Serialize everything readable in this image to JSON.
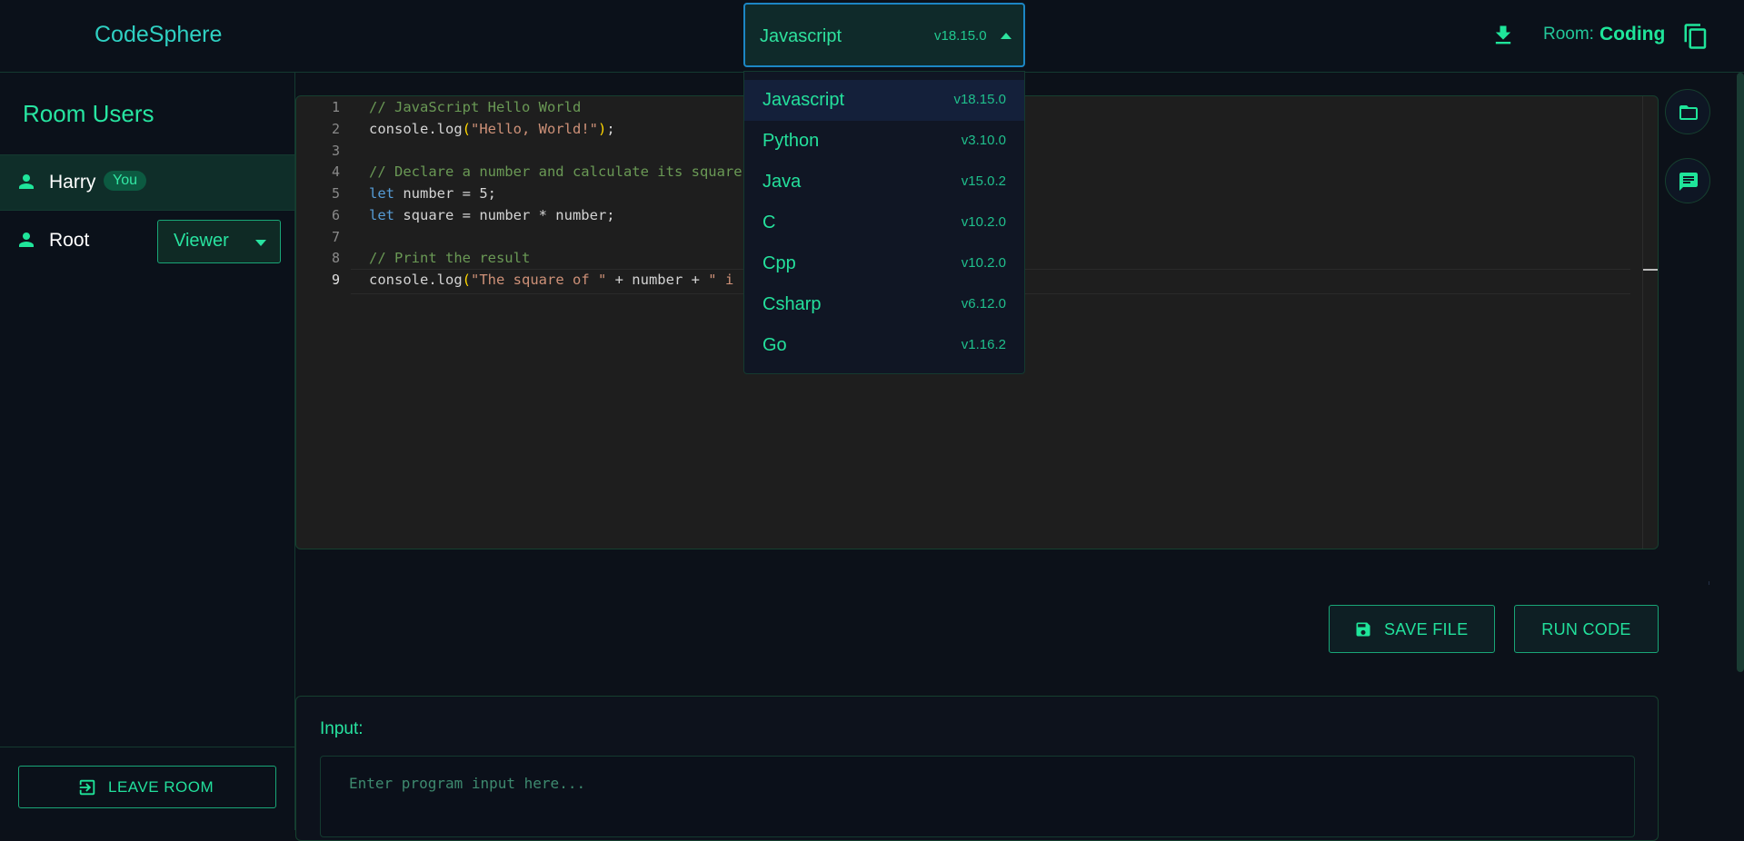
{
  "header": {
    "logo": "CodeSphere",
    "room_label": "Room:",
    "room_name": "Coding",
    "icons": {
      "download": "download-icon",
      "copy": "copy-icon"
    }
  },
  "language_select": {
    "selected": {
      "name": "Javascript",
      "version": "v18.15.0"
    },
    "options": [
      {
        "name": "Javascript",
        "version": "v18.15.0"
      },
      {
        "name": "Python",
        "version": "v3.10.0"
      },
      {
        "name": "Java",
        "version": "v15.0.2"
      },
      {
        "name": "C",
        "version": "v10.2.0"
      },
      {
        "name": "Cpp",
        "version": "v10.2.0"
      },
      {
        "name": "Csharp",
        "version": "v6.12.0"
      },
      {
        "name": "Go",
        "version": "v1.16.2"
      }
    ]
  },
  "sidebar": {
    "title": "Room Users",
    "users": [
      {
        "name": "Harry",
        "badge": "You"
      },
      {
        "name": "Root",
        "role": "Viewer"
      }
    ],
    "leave_label": "LEAVE ROOM"
  },
  "editor": {
    "line_numbers": [
      "1",
      "2",
      "3",
      "4",
      "5",
      "6",
      "7",
      "8",
      "9"
    ],
    "lines": [
      "// JavaScript Hello World",
      "console.log(\"Hello, World!\");",
      "",
      "// Declare a number and calculate its square",
      "let number = 5;",
      "let square = number * number;",
      "",
      "// Print the result",
      "console.log(\"The square of \" + number + \" i"
    ]
  },
  "actions": {
    "save_label": "SAVE FILE",
    "run_label": "RUN CODE"
  },
  "input_panel": {
    "label": "Input:",
    "placeholder": "Enter program input here..."
  },
  "colors": {
    "accent": "#22e09c",
    "logo": "#2fd0c2",
    "background": "#0c1119",
    "editor_bg": "#1e1e1e"
  }
}
